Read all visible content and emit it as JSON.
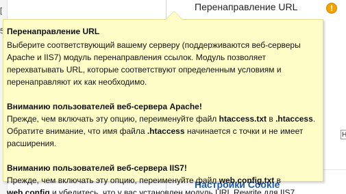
{
  "background": {
    "left_fragments": [
      "[",
      "5"
    ],
    "setting_label": "Перенаправление URL",
    "warning_icon": "exclamation-icon",
    "warning_glyph": "!",
    "side_hint_text": "H",
    "bottom_link": "Настройки Cookie"
  },
  "tooltip": {
    "title": "Перенаправление URL",
    "intro": "Выберите соответствующий вашему серверу (поддерживаются веб-серверы Apache и IIS7) модуль перенаправления ссылок. Модуль позволяет перехватывать URL, которые соответствуют определенным условиям и перенаправляют их как необходимо.",
    "apache": {
      "heading": "Вниманию пользователей веб-сервера Apache!",
      "t1": "Прежде, чем включать эту опцию, переименуйте файл ",
      "b1": "htaccess.txt",
      "t2": " в ",
      "b2": ".htaccess",
      "t3": ". Обратите внимание, что имя файла ",
      "b3": ".htaccess",
      "t4": " начинается с точки и не имеет расширения."
    },
    "iis": {
      "heading": "Вниманию пользователей веб-сервера IIS7!",
      "t1": "Прежде, чем включать эту опцию, переименуйте файл ",
      "b1": "web.config.txt",
      "t2": " в ",
      "b2": "web.config",
      "t3": " и убедитесь, что у вас установлен модуль URL Rewrite для IIS7."
    }
  },
  "colors": {
    "tooltip_bg": "#fffdc7",
    "tooltip_border": "#e1dd8c",
    "warning": "#f3a300",
    "link": "#1d5cae"
  }
}
